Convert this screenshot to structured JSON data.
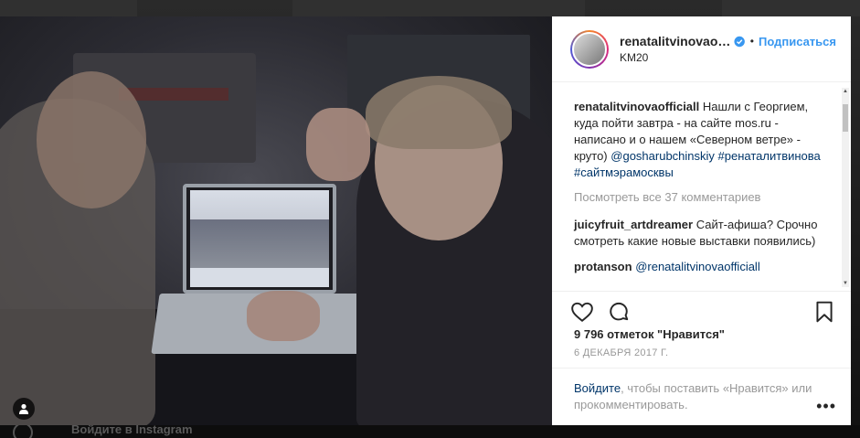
{
  "post": {
    "username": "renatalitvinovaoff...",
    "follow_label": "Подписаться",
    "separator": "•",
    "location": "KM20"
  },
  "caption": {
    "username": "renatalitvinovaofficiall",
    "text": "Нашли с Георгием, куда пойти завтра - на сайте mos.ru - написано и о нашем «Северном ветре» - круто)",
    "mention": "@gosharubchinskiy",
    "hashtags": "#ренаталитвинова #сайтмэрамосквы"
  },
  "view_all_comments": "Посмотреть все 37 комментариев",
  "comments": [
    {
      "username": "juicyfruit_artdreamer",
      "text": "Сайт-афиша? Срочно смотреть какие новые выставки появились)"
    },
    {
      "username": "protanson",
      "mention": "@renatalitvinovaofficiall"
    }
  ],
  "likes": "9 796 отметок \"Нравится\"",
  "date": "6 ДЕКАБРЯ 2017 Г.",
  "login": {
    "link": "Войдите",
    "text": ", чтобы поставить «Нравится» или прокомментировать."
  },
  "more_label": "•••",
  "background": {
    "footer_text": "Войдите в Instagram"
  },
  "icons": [
    "heart-icon",
    "comment-icon",
    "bookmark-icon",
    "verified-icon",
    "user-tag-icon"
  ],
  "colors": {
    "accent": "#3897f0",
    "link": "#003569",
    "muted": "#999999",
    "text": "#262626"
  }
}
